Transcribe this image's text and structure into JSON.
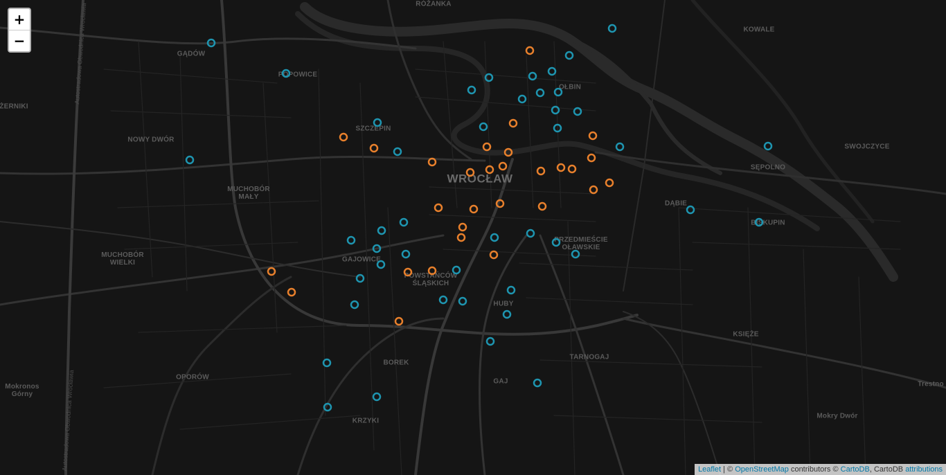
{
  "zoom": {
    "in_label": "+",
    "out_label": "−"
  },
  "place_labels": [
    "RÓŻANKA",
    "KOWALE",
    "GĄDÓW",
    "POPOWICE",
    "OŁBIN",
    "ŻERNIKI",
    "SZCZEPIN",
    "NOWY DWÓR",
    "SWOJCZYCE",
    "WROCŁAW",
    "SĘPOLNO",
    "MUCHOBÓR\nMAŁY",
    "DĄBIE",
    "BISKUPIN",
    "PRZEDMIEŚCIE\nOŁAWSKIE",
    "MUCHOBÓR\nWIELKI",
    "GAJOWICE",
    "POWSTAŃCÓW\nŚLĄSKICH",
    "HUBY",
    "KSIĘŻE",
    "TARNOGAJ",
    "BOREK",
    "OPORÓW",
    "GAJ",
    "Mokronos\nGórny",
    "Trestno",
    "KRZYKI",
    "Mokry Dwór"
  ],
  "road_labels": [
    "Autostradowa Obwodnica Wrocławia",
    "Autostradowa Obwodnica Wrocławia"
  ],
  "marker_colors": {
    "orange": "#e8802c",
    "blue": "#1e95b0"
  },
  "attribution": {
    "leaflet": "Leaflet",
    "sep1": " | © ",
    "osm": "OpenStreetMap",
    "contributors": " contributors © ",
    "cartodb": "CartoDB",
    "cartodb_suffix": ", CartoDB ",
    "attributions": "attributions"
  }
}
